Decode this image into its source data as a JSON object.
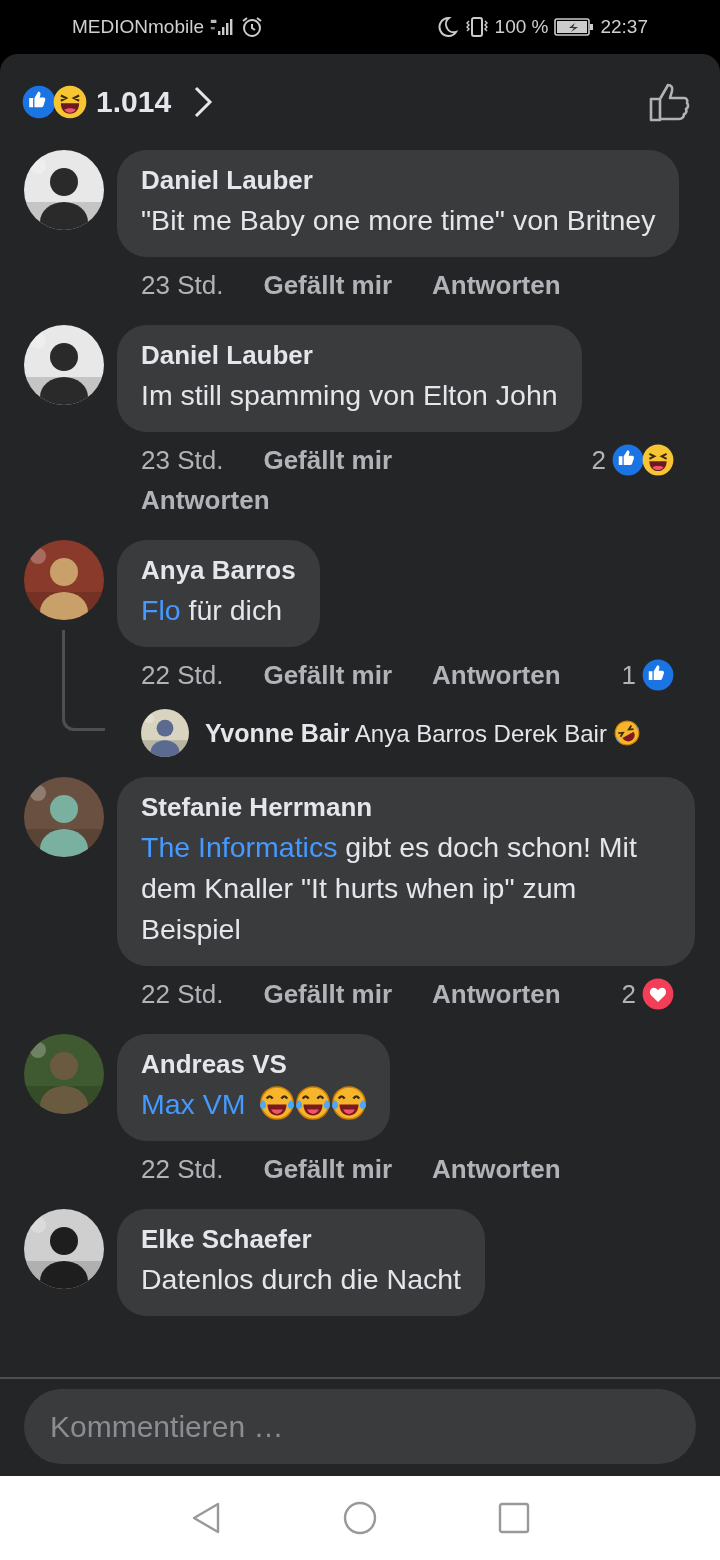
{
  "status_bar": {
    "carrier": "MEDIONmobile",
    "battery": "100 %",
    "time": "22:37"
  },
  "header": {
    "reactions": [
      {
        "kind": "like"
      },
      {
        "kind": "haha"
      }
    ],
    "count": "1.014"
  },
  "comments": [
    {
      "name": "Daniel Lauber",
      "text": "\"Bit me Baby one more time\" von Britney",
      "time": "23 Std.",
      "like_label": "Gefällt mir",
      "reply_label": "Antworten",
      "avatar": {
        "kind": "picture"
      }
    },
    {
      "name": "Daniel Lauber",
      "text": "Im still spamming von Elton John",
      "time": "23 Std.",
      "like_label": "Gefällt mir",
      "reply_label": "Antworten",
      "reaction_count": "2",
      "reactions": [
        {
          "kind": "like"
        },
        {
          "kind": "haha"
        }
      ],
      "avatar": {
        "kind": "picture"
      }
    },
    {
      "name": "Anya Barros",
      "mention": "Flo",
      "text": "für dich",
      "time": "22 Std.",
      "like_label": "Gefällt mir",
      "reply_label": "Antworten",
      "reaction_count": "1",
      "reactions": [
        {
          "kind": "like"
        }
      ],
      "avatar": {
        "kind": "picture"
      },
      "replies": [
        {
          "name": "Yvonne Bair",
          "text": "Anya Barros Derek Bair",
          "emojis": [
            {
              "kind": "rofl"
            }
          ],
          "avatar": {
            "kind": "picture"
          }
        }
      ]
    },
    {
      "name": "Stefanie Herrmann",
      "mention": "The Informatics",
      "text": "gibt es doch schon! Mit dem Knaller \"It hurts when ip\" zum Beispiel",
      "time": "22 Std.",
      "like_label": "Gefällt mir",
      "reply_label": "Antworten",
      "reaction_count": "2",
      "reactions": [
        {
          "kind": "love"
        }
      ],
      "avatar": {
        "kind": "picture"
      }
    },
    {
      "name": "Andreas VS",
      "mention": "Max VM",
      "emojis": [
        {
          "kind": "tears_of_joy"
        },
        {
          "kind": "tears_of_joy"
        },
        {
          "kind": "tears_of_joy"
        }
      ],
      "time": "22 Std.",
      "like_label": "Gefällt mir",
      "reply_label": "Antworten",
      "avatar": {
        "kind": "picture"
      }
    },
    {
      "name": "Elke Schaefer",
      "text": "Datenlos durch die Nacht",
      "avatar": {
        "kind": "picture"
      }
    }
  ],
  "composer": {
    "placeholder": "Kommentieren …"
  }
}
